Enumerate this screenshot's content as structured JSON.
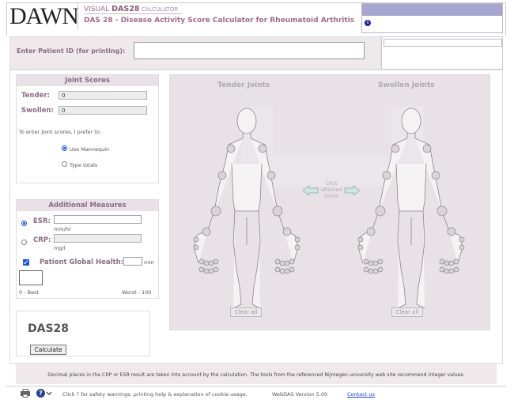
{
  "header": {
    "logo": "DAWN",
    "title_prefix": "VISUAL ",
    "title_main": "DAS28",
    "title_suffix": " CALCULATOR",
    "subtitle": "DAS 28 - Disease Activity Score Calculator for Rheumatoid Arthritis"
  },
  "patient": {
    "label": "Enter Patient ID (for printing):",
    "value": ""
  },
  "joint_scores": {
    "title": "Joint Scores",
    "tender_label": "Tender:",
    "tender_value": "0",
    "swollen_label": "Swollen:",
    "swollen_value": "0",
    "prefer_text": "To enter joint scores, I prefer to:",
    "option_mannequin": "Use Mannequin",
    "option_totals": "Type totals",
    "selected_option": "mannequin"
  },
  "additional": {
    "title": "Additional Measures",
    "esr_label": "ESR:",
    "esr_unit": "mm/hr",
    "crp_label": "CRP:",
    "crp_unit": "mg/l",
    "global_label": "Patient Global Health:",
    "global_unit": "mm",
    "scale_best": "0 - Best",
    "scale_worst": "Worst - 100",
    "selected_measure": "esr",
    "global_checked": true
  },
  "das": {
    "title": "DAS28",
    "calculate_label": "Calculate"
  },
  "mannequins": {
    "tender_title": "Tender Joints",
    "swollen_title": "Swollen Joints",
    "hint": "Click affected joints",
    "clear_label": "Clear all"
  },
  "notice": "Decimal places in the CRP or ESR result are taken into account by the calculation. The tools from the referenced Nijmegen university web site recommend integer values.",
  "footer": {
    "help_text": "Click ? for safety warnings, printing help & explanation of cookie usage.",
    "version": "WebDAS Version 5.00",
    "contact": "Contact us",
    "help_glyph": "?"
  },
  "colors": {
    "accent": "#8a6b83",
    "panel": "#e8e2e6",
    "link": "#1a3fc9"
  }
}
